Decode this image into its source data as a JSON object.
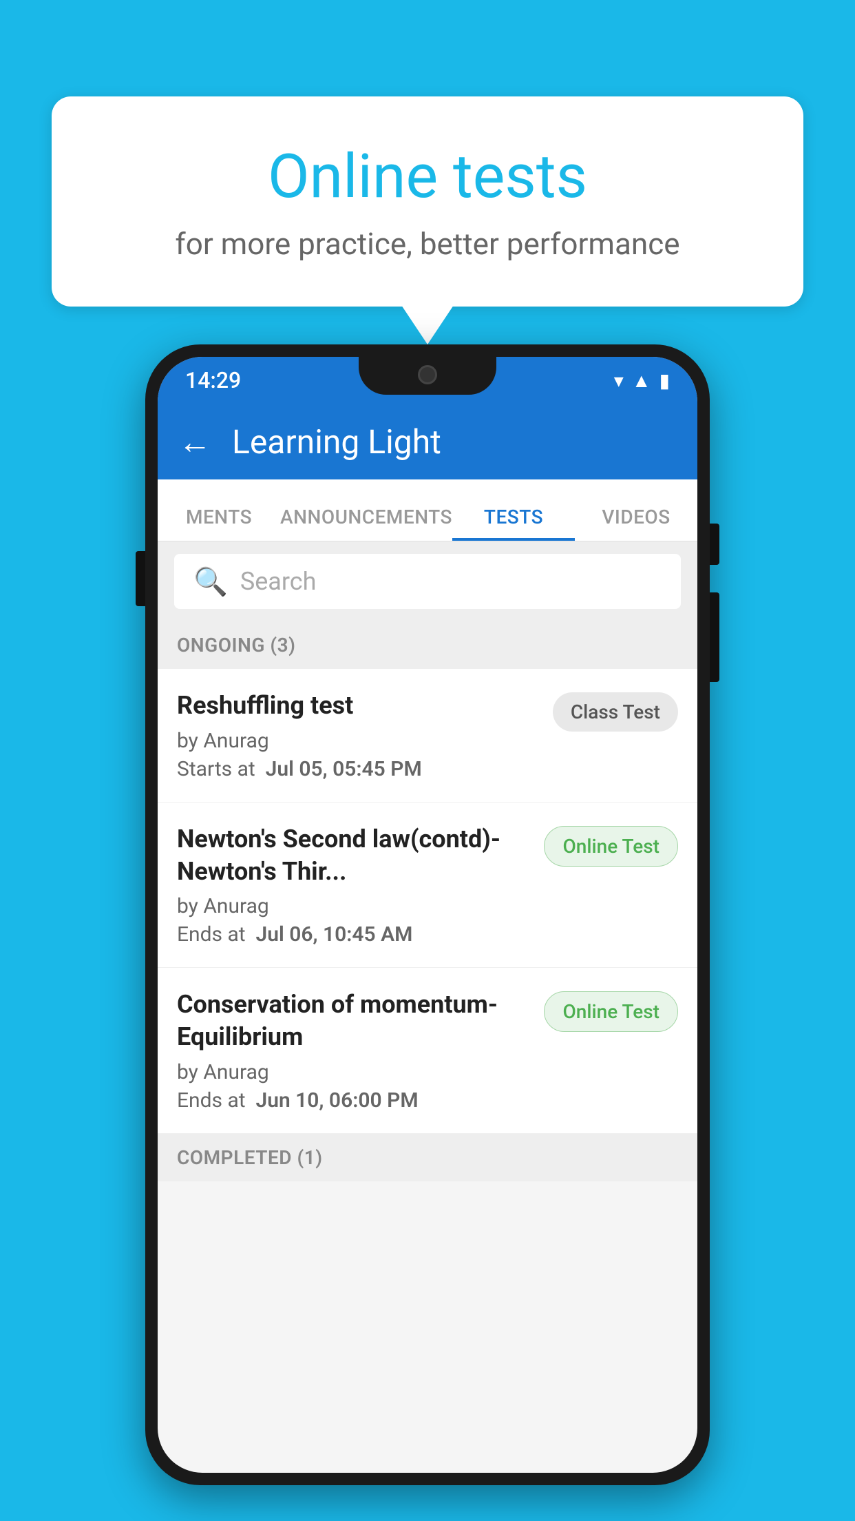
{
  "background_color": "#1ab8e8",
  "speech_bubble": {
    "title": "Online tests",
    "subtitle": "for more practice, better performance"
  },
  "status_bar": {
    "time": "14:29",
    "icons": [
      "wifi",
      "signal",
      "battery"
    ]
  },
  "app_bar": {
    "title": "Learning Light",
    "back_label": "←"
  },
  "tabs": [
    {
      "label": "MENTS",
      "active": false
    },
    {
      "label": "ANNOUNCEMENTS",
      "active": false
    },
    {
      "label": "TESTS",
      "active": true
    },
    {
      "label": "VIDEOS",
      "active": false
    }
  ],
  "search": {
    "placeholder": "Search"
  },
  "sections": [
    {
      "label": "ONGOING (3)",
      "tests": [
        {
          "name": "Reshuffling test",
          "author": "by Anurag",
          "date_label": "Starts at",
          "date": "Jul 05, 05:45 PM",
          "badge": "Class Test",
          "badge_type": "class"
        },
        {
          "name": "Newton's Second law(contd)-Newton's Thir...",
          "author": "by Anurag",
          "date_label": "Ends at",
          "date": "Jul 06, 10:45 AM",
          "badge": "Online Test",
          "badge_type": "online"
        },
        {
          "name": "Conservation of momentum-Equilibrium",
          "author": "by Anurag",
          "date_label": "Ends at",
          "date": "Jun 10, 06:00 PM",
          "badge": "Online Test",
          "badge_type": "online"
        }
      ]
    }
  ],
  "completed_label": "COMPLETED (1)"
}
